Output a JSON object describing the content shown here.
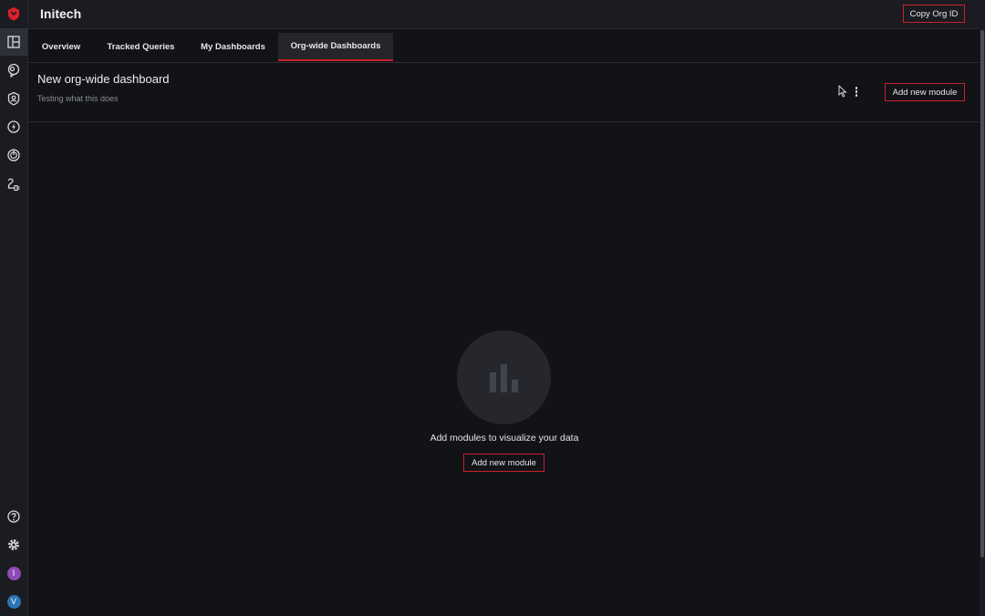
{
  "app": {
    "org_name": "Initech",
    "copy_org_id_label": "Copy Org ID",
    "brand_color": "#c8202a"
  },
  "sidebar": {
    "items": [
      {
        "name": "dashboards-icon",
        "active": true
      },
      {
        "name": "insights-icon"
      },
      {
        "name": "shield-icon"
      },
      {
        "name": "lightning-icon"
      },
      {
        "name": "radar-icon"
      },
      {
        "name": "integrations-icon"
      }
    ],
    "bottom": [
      {
        "name": "help-icon"
      },
      {
        "name": "settings-icon"
      }
    ],
    "org_avatar": {
      "initial": "I",
      "color": "#8f4bb5"
    },
    "user_avatar": {
      "initial": "V",
      "color": "#2a74b5"
    }
  },
  "tabs": [
    {
      "label": "Overview"
    },
    {
      "label": "Tracked Queries"
    },
    {
      "label": "My Dashboards"
    },
    {
      "label": "Org-wide Dashboards",
      "active": true
    }
  ],
  "dashboard": {
    "title": "New org-wide dashboard",
    "description": "Testing what this does",
    "add_module_label": "Add new module"
  },
  "empty_state": {
    "message": "Add modules to visualize your data",
    "add_module_label": "Add new module"
  }
}
